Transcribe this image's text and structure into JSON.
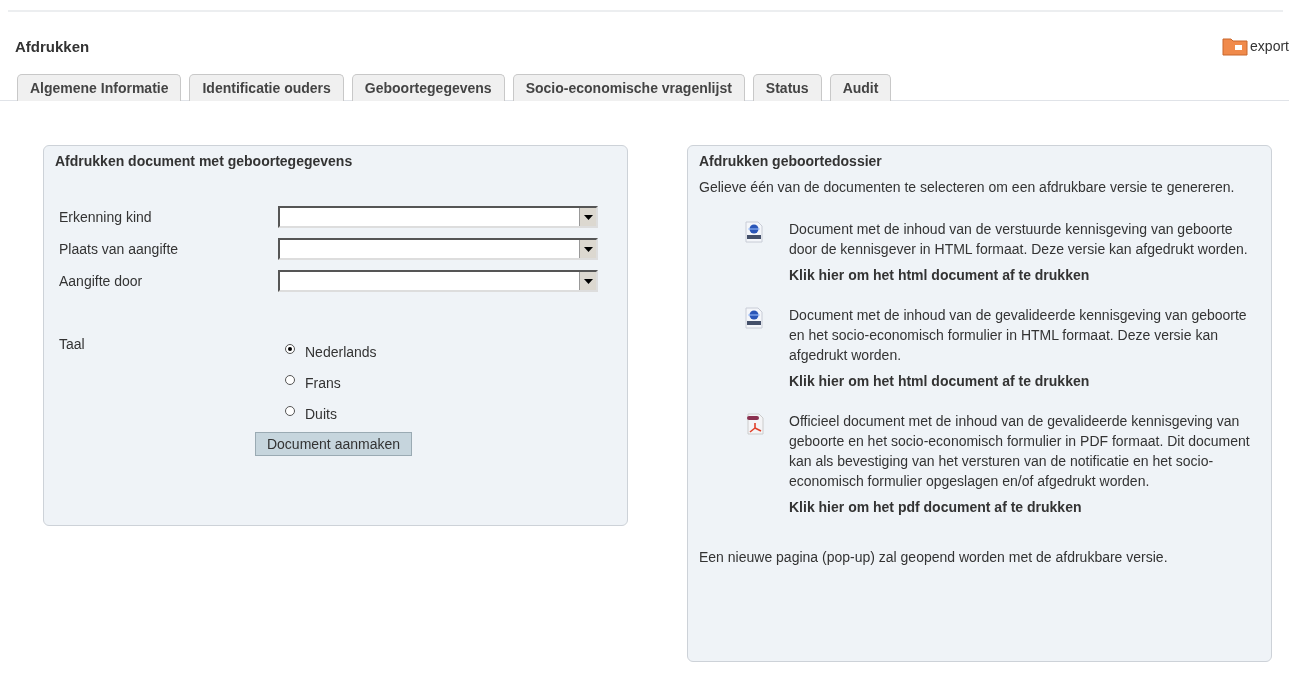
{
  "page": {
    "title": "Afdrukken",
    "export_label": "export"
  },
  "tabs": [
    {
      "label": "Algemene Informatie",
      "selected": false
    },
    {
      "label": "Identificatie ouders",
      "selected": false
    },
    {
      "label": "Geboortegegevens",
      "selected": false
    },
    {
      "label": "Socio-economische vragenlijst",
      "selected": false
    },
    {
      "label": "Status",
      "selected": false
    },
    {
      "label": "Audit",
      "selected": false
    }
  ],
  "form_panel": {
    "title": "Afdrukken document met geboortegegevens",
    "selects": [
      {
        "label": "Erkenning kind"
      },
      {
        "label": "Plaats van aangifte"
      },
      {
        "label": "Aangifte door"
      }
    ],
    "language_label": "Taal",
    "languages": [
      {
        "label": "Nederlands",
        "selected": true
      },
      {
        "label": "Frans",
        "selected": false
      },
      {
        "label": "Duits",
        "selected": false
      }
    ],
    "button": "Document aanmaken"
  },
  "dossier_panel": {
    "title": "Afdrukken geboortedossier",
    "intro": "Gelieve één van de documenten te selecteren om een afdrukbare versie te genereren.",
    "documents": [
      {
        "kind": "html",
        "description": "Document met de inhoud van de verstuurde kennisgeving van geboorte door de kennisgever in HTML formaat. Deze versie kan afgedrukt worden.",
        "link": "Klik hier om het html document af te drukken"
      },
      {
        "kind": "html",
        "description": "Document met de inhoud van de gevalideerde kennisgeving van geboorte en het socio-economisch formulier in HTML formaat. Deze versie kan afgedrukt worden.",
        "link": "Klik hier om het html document af te drukken"
      },
      {
        "kind": "pdf",
        "description": "Officieel document met de inhoud van de gevalideerde kennisgeving van geboorte en het socio-economisch formulier in PDF formaat. Dit document kan als bevestiging van het versturen van de notificatie en het socio-economisch formulier opgeslagen en/of afgedrukt worden.",
        "link": "Klik hier om het pdf document af te drukken"
      }
    ],
    "footer": "Een nieuwe pagina (pop-up) zal geopend worden met de afdrukbare versie."
  }
}
